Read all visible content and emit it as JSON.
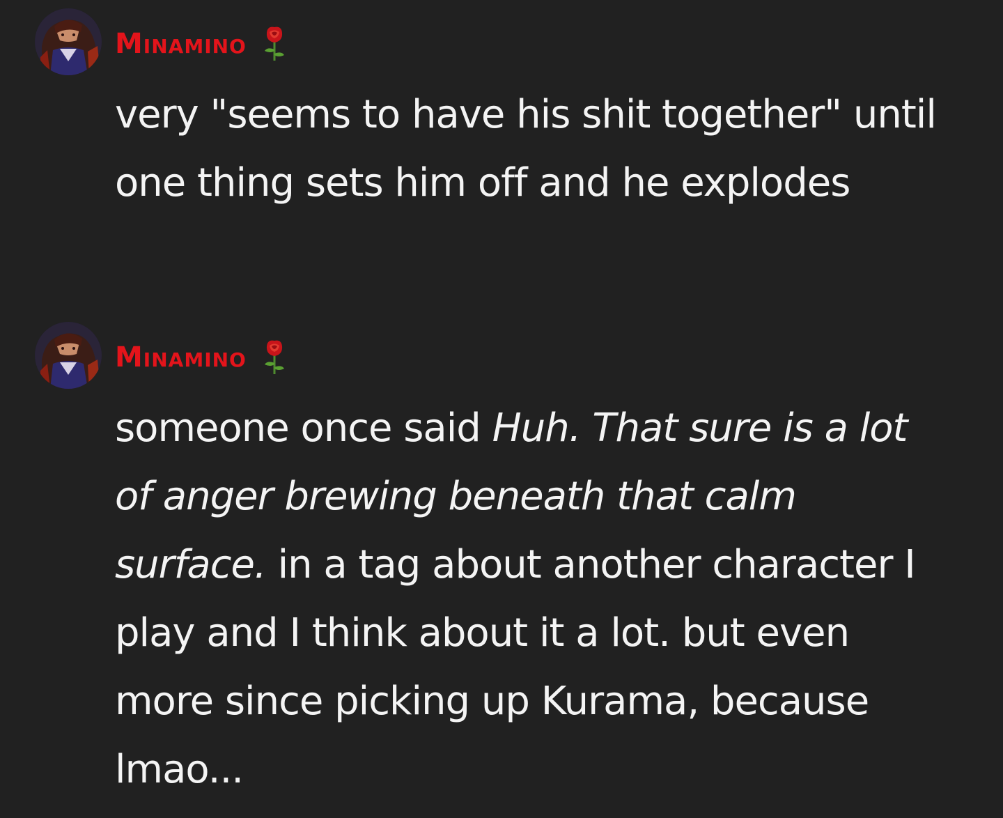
{
  "messages": [
    {
      "username": "Minamino",
      "username_color": "#e3141b",
      "badge_icon": "rose-icon",
      "avatar_icon": "avatar",
      "text": "very \"seems to have his shit together\" until one thing sets him off and he explodes"
    },
    {
      "username": "Minamino",
      "username_color": "#e3141b",
      "badge_icon": "rose-icon",
      "avatar_icon": "avatar",
      "text_before": "someone once said ",
      "text_italic": "Huh. That sure is a lot of anger brewing beneath that calm surface.",
      "text_after": " in a tag about another character I play and I think about it a lot. but even more since picking up Kurama, because lmao..."
    }
  ],
  "colors": {
    "background": "#212121",
    "text": "#f4f4f4"
  }
}
